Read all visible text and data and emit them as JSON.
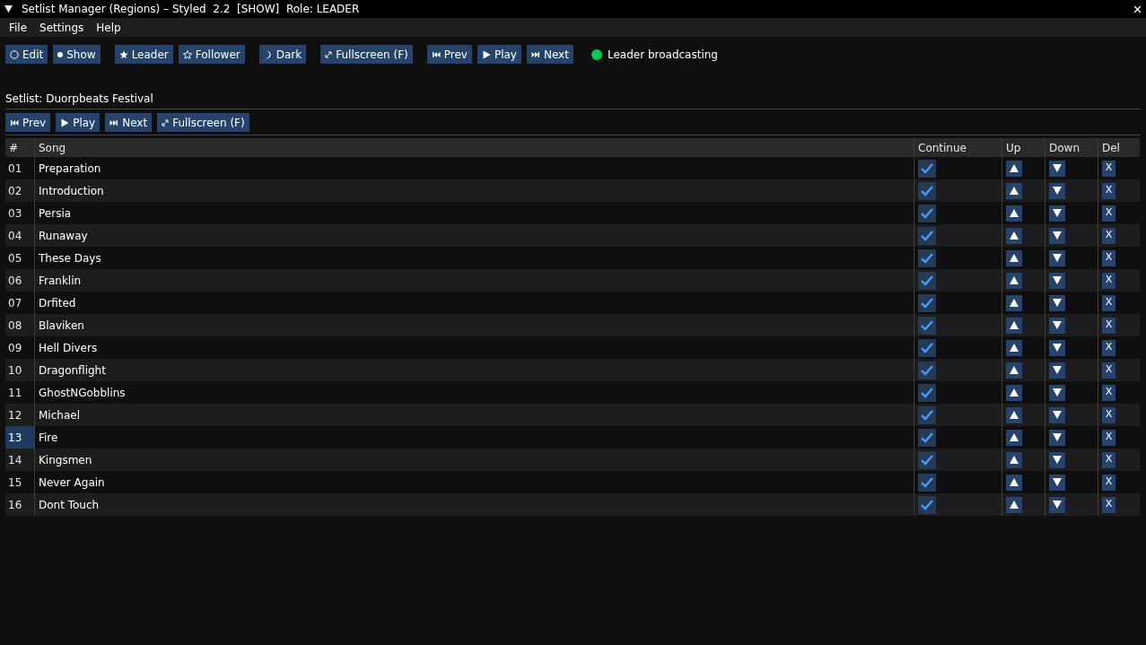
{
  "window": {
    "title": "Setlist Manager (Regions) – Styled  2.2  [SHOW]  Role: LEADER"
  },
  "menu": [
    "File",
    "Settings",
    "Help"
  ],
  "toolbar": [
    {
      "kind": "mode",
      "label": "Edit",
      "selected": false
    },
    {
      "kind": "mode",
      "label": "Show",
      "selected": true
    },
    {
      "kind": "role",
      "label": "Leader",
      "selected": true
    },
    {
      "kind": "role",
      "label": "Follower",
      "selected": false
    },
    {
      "kind": "theme",
      "label": "Dark"
    },
    {
      "kind": "fullscreen",
      "label": "Fullscreen (F)"
    },
    {
      "kind": "prev",
      "label": "Prev"
    },
    {
      "kind": "play",
      "label": "Play"
    },
    {
      "kind": "next",
      "label": "Next"
    }
  ],
  "status": {
    "label": "Leader broadcasting",
    "color": "#00c853"
  },
  "setlist": {
    "title": "Setlist: Duorpbeats Festival",
    "controls": [
      {
        "kind": "prev",
        "label": "Prev"
      },
      {
        "kind": "play",
        "label": "Play"
      },
      {
        "kind": "next",
        "label": "Next"
      },
      {
        "kind": "fullscreen",
        "label": "Fullscreen (F)"
      }
    ],
    "columns": [
      "#",
      "Song",
      "Continue",
      "Up",
      "Down",
      "Del"
    ],
    "rows": [
      {
        "number": "01",
        "song": "Preparation",
        "continue": true,
        "selected": false,
        "delete": "X"
      },
      {
        "number": "02",
        "song": "Introduction",
        "continue": true,
        "selected": false,
        "delete": "X"
      },
      {
        "number": "03",
        "song": "Persia",
        "continue": true,
        "selected": false,
        "delete": "X"
      },
      {
        "number": "04",
        "song": "Runaway",
        "continue": true,
        "selected": false,
        "delete": "X"
      },
      {
        "number": "05",
        "song": "These Days",
        "continue": true,
        "selected": false,
        "delete": "X"
      },
      {
        "number": "06",
        "song": "Franklin",
        "continue": true,
        "selected": false,
        "delete": "X"
      },
      {
        "number": "07",
        "song": "Drfited",
        "continue": true,
        "selected": false,
        "delete": "X"
      },
      {
        "number": "08",
        "song": "Blaviken",
        "continue": true,
        "selected": false,
        "delete": "X"
      },
      {
        "number": "09",
        "song": "Hell Divers",
        "continue": true,
        "selected": false,
        "delete": "X"
      },
      {
        "number": "10",
        "song": "Dragonflight",
        "continue": true,
        "selected": false,
        "delete": "X"
      },
      {
        "number": "11",
        "song": "GhostNGobblins",
        "continue": true,
        "selected": false,
        "delete": "X"
      },
      {
        "number": "12",
        "song": "Michael",
        "continue": true,
        "selected": false,
        "delete": "X"
      },
      {
        "number": "13",
        "song": "Fire",
        "continue": true,
        "selected": true,
        "delete": "X"
      },
      {
        "number": "14",
        "song": "Kingsmen",
        "continue": true,
        "selected": false,
        "delete": "X"
      },
      {
        "number": "15",
        "song": "Never Again",
        "continue": true,
        "selected": false,
        "delete": "X"
      },
      {
        "number": "16",
        "song": "Dont Touch",
        "continue": true,
        "selected": false,
        "delete": "X"
      }
    ]
  }
}
